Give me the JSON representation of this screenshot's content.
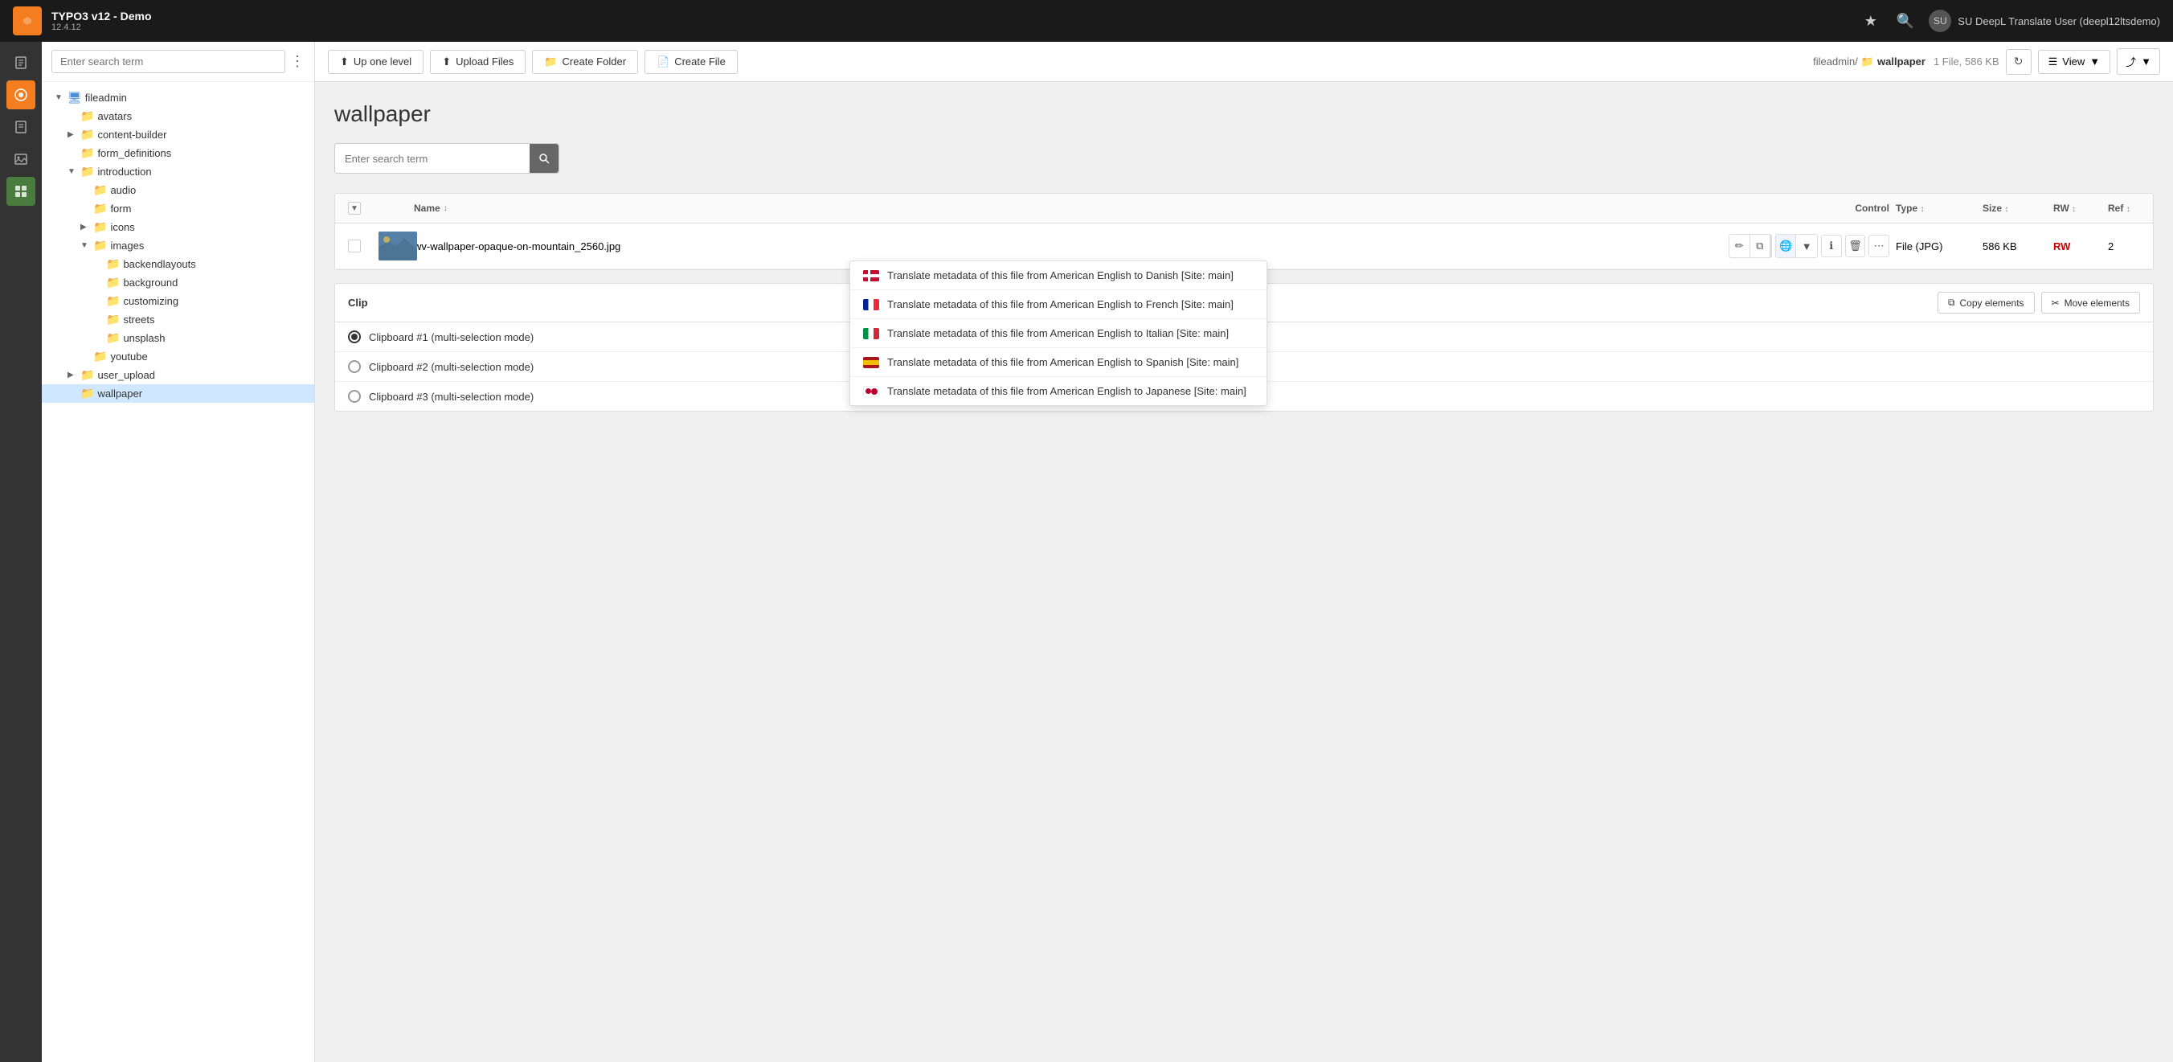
{
  "topbar": {
    "app_name": "TYPO3 v12 - Demo",
    "version": "12.4.12",
    "user": "SU DeepL Translate User (deepl12ltsdemo)"
  },
  "sidebar": {
    "search_placeholder": "Enter search term",
    "tree": [
      {
        "label": "fileadmin",
        "level": 0,
        "type": "root",
        "expanded": true
      },
      {
        "label": "avatars",
        "level": 1,
        "type": "folder"
      },
      {
        "label": "content-builder",
        "level": 1,
        "type": "folder",
        "expandable": true
      },
      {
        "label": "form_definitions",
        "level": 1,
        "type": "folder"
      },
      {
        "label": "introduction",
        "level": 1,
        "type": "folder",
        "expanded": true
      },
      {
        "label": "audio",
        "level": 2,
        "type": "folder"
      },
      {
        "label": "form",
        "level": 2,
        "type": "folder"
      },
      {
        "label": "icons",
        "level": 2,
        "type": "folder",
        "expandable": true
      },
      {
        "label": "images",
        "level": 2,
        "type": "folder",
        "expanded": true
      },
      {
        "label": "backendlayouts",
        "level": 3,
        "type": "folder"
      },
      {
        "label": "background",
        "level": 3,
        "type": "folder"
      },
      {
        "label": "customizing",
        "level": 3,
        "type": "folder"
      },
      {
        "label": "streets",
        "level": 3,
        "type": "folder"
      },
      {
        "label": "unsplash",
        "level": 3,
        "type": "folder"
      },
      {
        "label": "youtube",
        "level": 2,
        "type": "folder"
      },
      {
        "label": "user_upload",
        "level": 1,
        "type": "folder",
        "expandable": true
      },
      {
        "label": "wallpaper",
        "level": 1,
        "type": "folder",
        "active": true
      }
    ]
  },
  "toolbar": {
    "up_one_level": "Up one level",
    "upload_files": "Upload Files",
    "create_folder": "Create Folder",
    "create_file": "Create File",
    "view_label": "View",
    "breadcrumb_root": "fileadmin/",
    "breadcrumb_current": "wallpaper",
    "file_count": "1 File, 586 KB"
  },
  "main": {
    "page_title": "wallpaper",
    "search_placeholder": "Enter search term",
    "table": {
      "headers": {
        "name": "Name",
        "control": "Control",
        "type": "Type",
        "size": "Size",
        "rw": "RW",
        "ref": "Ref"
      },
      "rows": [
        {
          "name": "wv-wallpaper-opaque-on-mountain_2560.jpg",
          "type": "File (JPG)",
          "size": "586 KB",
          "rw": "RW",
          "ref": "2"
        }
      ]
    }
  },
  "dropdown": {
    "items": [
      {
        "flag": "dk",
        "label": "Translate metadata of this file from American English to Danish [Site: main]"
      },
      {
        "flag": "fr",
        "label": "Translate metadata of this file from American English to French [Site: main]"
      },
      {
        "flag": "it",
        "label": "Translate metadata of this file from American English to Italian [Site: main]"
      },
      {
        "flag": "es",
        "label": "Translate metadata of this file from American English to Spanish [Site: main]"
      },
      {
        "flag": "jp",
        "label": "Translate metadata of this file from American English to Japanese [Site: main]"
      }
    ]
  },
  "clipboard": {
    "title": "Clip",
    "copy_label": "Copy elements",
    "move_label": "Move elements",
    "items": [
      {
        "id": 1,
        "label": "Clipboard #1 (multi-selection mode)",
        "checked": true
      },
      {
        "id": 2,
        "label": "Clipboard #2 (multi-selection mode)",
        "checked": false
      },
      {
        "id": 3,
        "label": "Clipboard #3 (multi-selection mode)",
        "checked": false
      }
    ]
  },
  "icons": {
    "page": "📄",
    "eye": "👁",
    "doc": "📝",
    "image": "🖼",
    "module": "🟢",
    "folder": "📁",
    "chevron_right": "▶",
    "chevron_down": "▼",
    "search": "🔍",
    "upload": "⬆",
    "plus": "+",
    "edit": "✏",
    "copy": "⧉",
    "translate": "🌐",
    "view_info": "ℹ",
    "trash": "🗑",
    "more": "⋯",
    "refresh": "↻",
    "share": "⤴",
    "sort": "↕"
  }
}
